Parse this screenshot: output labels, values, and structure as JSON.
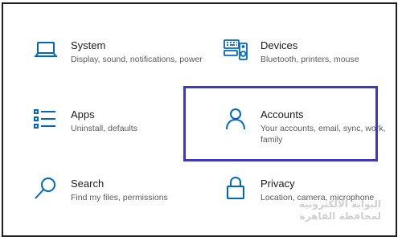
{
  "colors": {
    "accent": "#0067c0",
    "highlight_border": "#3c3ab8",
    "title_text": "#1b1b1b",
    "description_text": "#5a5a5a"
  },
  "tiles": {
    "system": {
      "title": "System",
      "description": "Display, sound, notifications, power",
      "icon": "laptop-icon"
    },
    "devices": {
      "title": "Devices",
      "description": "Bluetooth, printers, mouse",
      "icon": "keyboard-speaker-icon"
    },
    "apps": {
      "title": "Apps",
      "description": "Uninstall, defaults",
      "icon": "apps-list-icon"
    },
    "accounts": {
      "title": "Accounts",
      "description": "Your accounts, email, sync, work, family",
      "icon": "person-icon"
    },
    "search": {
      "title": "Search",
      "description": "Find my files, permissions",
      "icon": "magnifier-icon"
    },
    "privacy": {
      "title": "Privacy",
      "description": "Location, camera, microphone",
      "icon": "lock-icon"
    }
  },
  "watermark": {
    "line1": "البوابة الالكترونية",
    "line2": "لمحافظة القاهرة"
  }
}
